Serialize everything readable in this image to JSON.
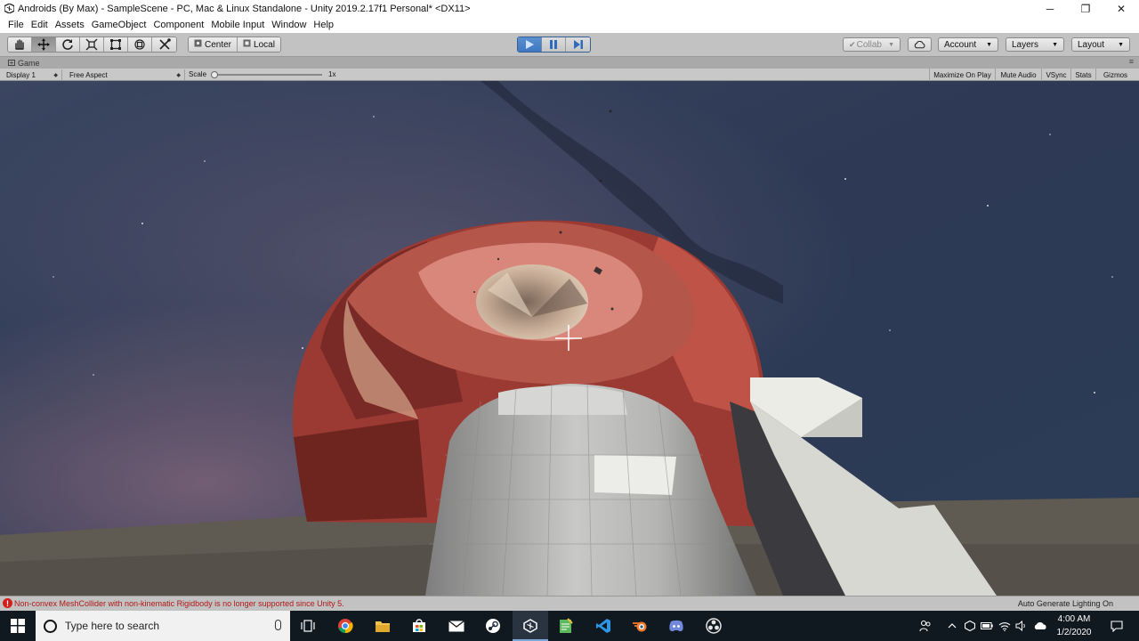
{
  "window": {
    "title": "Androids (By Max) - SampleScene - PC, Mac & Linux Standalone - Unity 2019.2.17f1 Personal* <DX11>",
    "minimize_glyph": "─",
    "maximize_glyph": "❐",
    "close_glyph": "✕"
  },
  "menu": [
    "File",
    "Edit",
    "Assets",
    "GameObject",
    "Component",
    "Mobile Input",
    "Window",
    "Help"
  ],
  "toolbar": {
    "tools": [
      "hand-tool-icon",
      "move-tool-icon",
      "rotate-tool-icon",
      "scale-tool-icon",
      "rect-tool-icon",
      "transform-tool-icon",
      "custom-tool-icon"
    ],
    "active_tool": "move-tool-icon",
    "pivot_mode": "Center",
    "pivot_rotation": "Local",
    "play_state": "playing",
    "collab": "Collab",
    "account": "Account",
    "layers": "Layers",
    "layout": "Layout"
  },
  "game_tab": {
    "label": "Game",
    "menu_glyph": "≡"
  },
  "game_bar": {
    "display": "Display 1",
    "aspect": "Free Aspect",
    "scale_label": "Scale",
    "scale_value": "1x",
    "scale_fraction": 0.0,
    "toggles": [
      "Maximize On Play",
      "Mute Audio",
      "VSync",
      "Stats",
      "Gizmos"
    ]
  },
  "status": {
    "error_icon": "!",
    "error": "Non-convex MeshCollider with non-kinematic Rigidbody is no longer supported since Unity 5.",
    "lighting": "Auto Generate Lighting On"
  },
  "taskbar": {
    "search_placeholder": "Type here to search",
    "apps": [
      "task-view-icon",
      "chrome-icon",
      "file-explorer-icon",
      "store-icon",
      "mail-icon",
      "steam-icon",
      "unity-icon",
      "notepad-icon",
      "visual-studio-icon",
      "blender-icon",
      "discord-icon",
      "obs-icon"
    ],
    "active_app": "unity-icon",
    "time": "4:00 AM",
    "date": "1/2/2020"
  },
  "colors": {
    "toolbar": "#c2c2c2",
    "play_blue": "#3e78c0",
    "error_red": "#b01818",
    "taskbar": "#101820",
    "sphere_red": "#b3443a"
  }
}
